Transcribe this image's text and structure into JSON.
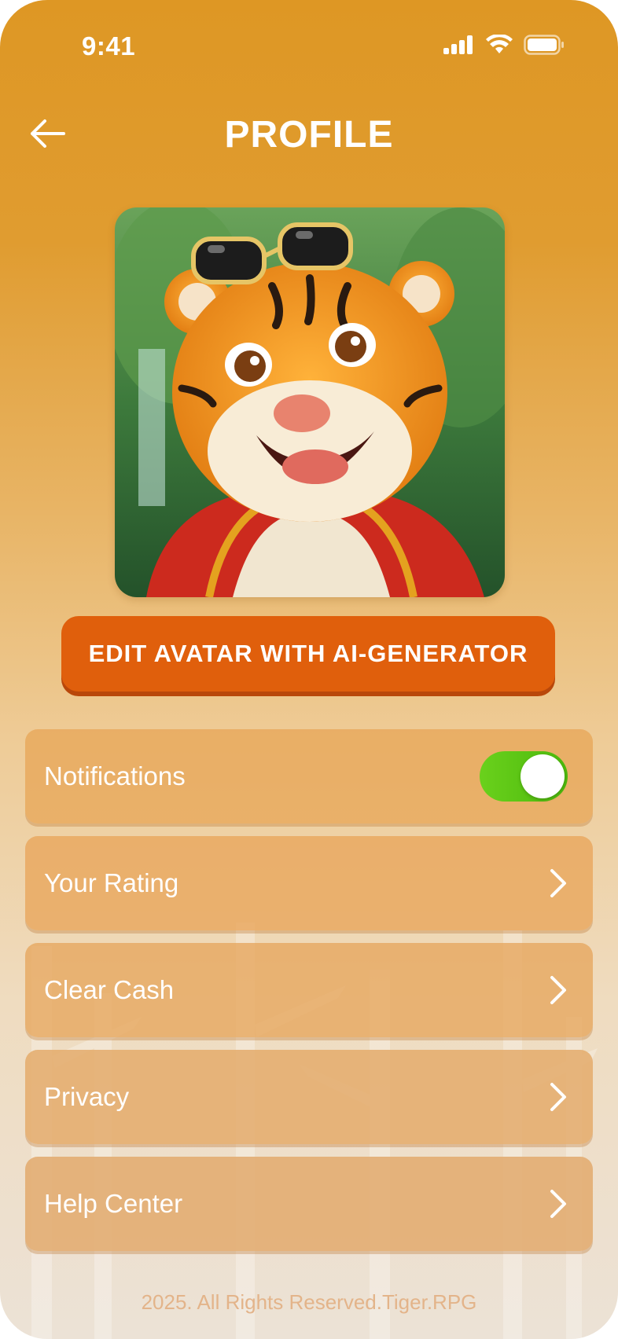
{
  "status_bar": {
    "time": "9:41"
  },
  "header": {
    "title": "PROFILE"
  },
  "avatar": {
    "description": "avatar-image"
  },
  "edit_button": {
    "label": "EDIT AVATAR WITH AI-GENERATOR"
  },
  "settings": {
    "items": [
      {
        "label": "Notifications",
        "control": "toggle",
        "on": true
      },
      {
        "label": "Your Rating",
        "control": "chevron"
      },
      {
        "label": "Clear Cash",
        "control": "chevron"
      },
      {
        "label": "Privacy",
        "control": "chevron"
      },
      {
        "label": "Help Center",
        "control": "chevron"
      }
    ]
  },
  "footer": {
    "text": "2025. All Rights Reserved.Tiger.RPG"
  },
  "colors": {
    "accent": "#e05f0c",
    "toggle_on": "#5cc414",
    "header_bg": "#de9724"
  },
  "icons": [
    "back-arrow-icon",
    "signal-icon",
    "wifi-icon",
    "battery-icon",
    "chevron-right-icon"
  ]
}
